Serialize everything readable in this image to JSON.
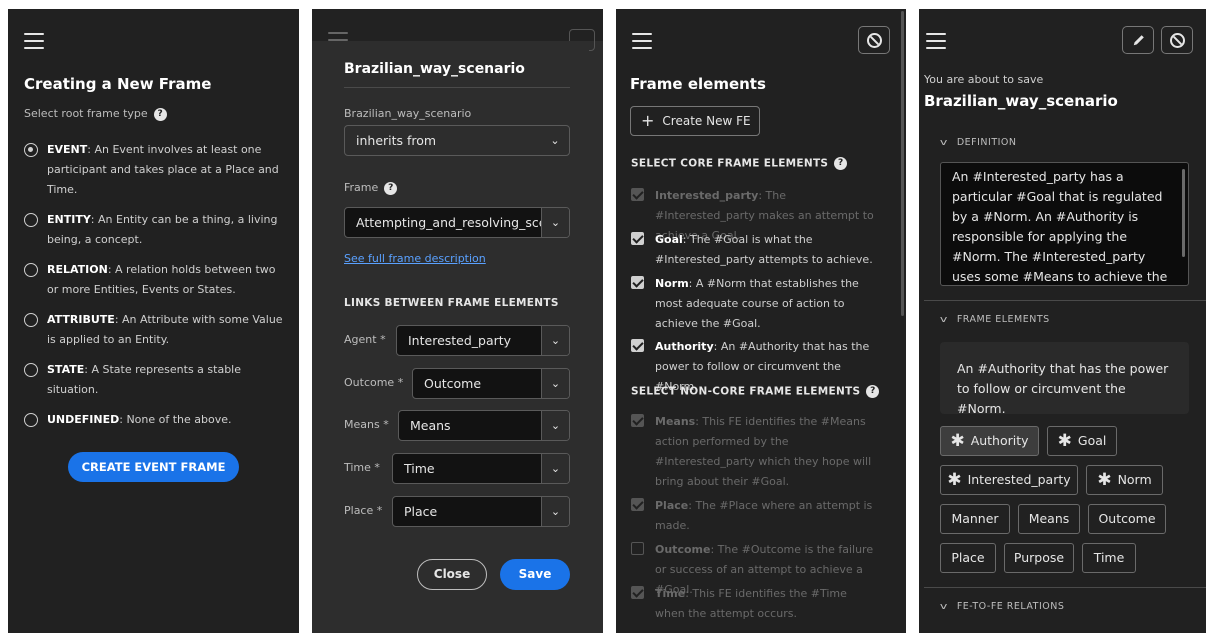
{
  "panel1": {
    "title": "Creating a New Frame",
    "subtitle": "Select root frame type",
    "options": [
      {
        "name": "EVENT",
        "desc": ": An Event involves at least one participant and takes place at a Place and Time.",
        "checked": true
      },
      {
        "name": "ENTITY",
        "desc": ": An Entity can be a thing, a living being, a concept.",
        "checked": false
      },
      {
        "name": "RELATION",
        "desc": ": A relation holds between two or more Entities, Events or States.",
        "checked": false
      },
      {
        "name": "ATTRIBUTE",
        "desc": ": An Attribute with some Value is applied to an Entity.",
        "checked": false
      },
      {
        "name": "STATE",
        "desc": ": A State represents a stable situation.",
        "checked": false
      },
      {
        "name": "UNDEFINED",
        "desc": ": None of the above.",
        "checked": false
      }
    ],
    "create_button": "CREATE EVENT FRAME"
  },
  "panel2": {
    "title": "Brazilian_way_scenario",
    "relation_label": "Brazilian_way_scenario",
    "relation_value": "inherits from",
    "frame_label": "Frame",
    "frame_value": "Attempting_and_resolving_scenario",
    "full_desc_link": "See full frame description",
    "links_head": "LINKS BETWEEN FRAME ELEMENTS",
    "links": [
      {
        "label": "Agent",
        "required": "*",
        "value": "Interested_party"
      },
      {
        "label": "Outcome",
        "required": "*",
        "value": "Outcome"
      },
      {
        "label": "Means",
        "required": "*",
        "value": "Means"
      },
      {
        "label": "Time",
        "required": "*",
        "value": "Time"
      },
      {
        "label": "Place",
        "required": "*",
        "value": "Place"
      }
    ],
    "close_button": "Close",
    "save_button": "Save"
  },
  "panel3": {
    "title": "Frame elements",
    "create_button": "Create New FE",
    "core_head": "SELECT CORE FRAME ELEMENTS",
    "core": [
      {
        "name": "Interested_party",
        "desc": ": The #Interested_party makes an attempt to achieve a Goal.",
        "checked": true,
        "disabled": true
      },
      {
        "name": "Goal",
        "desc": ": The #Goal is what the #Interested_party attempts to achieve.",
        "checked": true,
        "disabled": false
      },
      {
        "name": "Norm",
        "desc": ": A #Norm that establishes the most adequate course of action to achieve the #Goal.",
        "checked": true,
        "disabled": false
      },
      {
        "name": "Authority",
        "desc": ": An #Authority that has the power to follow or circumvent the #Norm.",
        "checked": true,
        "disabled": false
      }
    ],
    "noncore_head": "SELECT NON-CORE FRAME ELEMENTS",
    "noncore": [
      {
        "name": "Means",
        "desc": ": This FE identifies the #Means action performed by the #Interested_party which they hope will bring about their #Goal.",
        "checked": true
      },
      {
        "name": "Place",
        "desc": ": The #Place where an attempt is made.",
        "checked": true
      },
      {
        "name": "Outcome",
        "desc": ": The #Outcome is the failure or success of an attempt to achieve a #Goal.",
        "checked": false
      },
      {
        "name": "Time",
        "desc": ": This FE identifies the #Time when the attempt occurs.",
        "checked": true
      }
    ]
  },
  "panel4": {
    "pre_title": "You are about to save",
    "title": "Brazilian_way_scenario",
    "definition_head": "DEFINITION",
    "definition": "An #Interested_party has a particular #Goal that is regulated by a #Norm. An #Authority is responsible for applying the #Norm. The #Interested_party uses some #Means to achieve the #Goal without following the #Norm.",
    "fe_head": "FRAME ELEMENTS",
    "fe_desc": "An #Authority that has the power to follow or circumvent the #Norm.",
    "chips": [
      {
        "label": "Authority",
        "core": true
      },
      {
        "label": "Goal",
        "core": true
      },
      {
        "label": "Interested_party",
        "core": true
      },
      {
        "label": "Norm",
        "core": true
      },
      {
        "label": "Manner",
        "core": false
      },
      {
        "label": "Means",
        "core": false
      },
      {
        "label": "Outcome",
        "core": false
      },
      {
        "label": "Place",
        "core": false
      },
      {
        "label": "Purpose",
        "core": false
      },
      {
        "label": "Time",
        "core": false
      }
    ],
    "relations_head": "FE-TO-FE RELATIONS"
  },
  "colors": {
    "primary": "#1a73e8",
    "background": "#212121",
    "link": "#5aa1ff"
  }
}
